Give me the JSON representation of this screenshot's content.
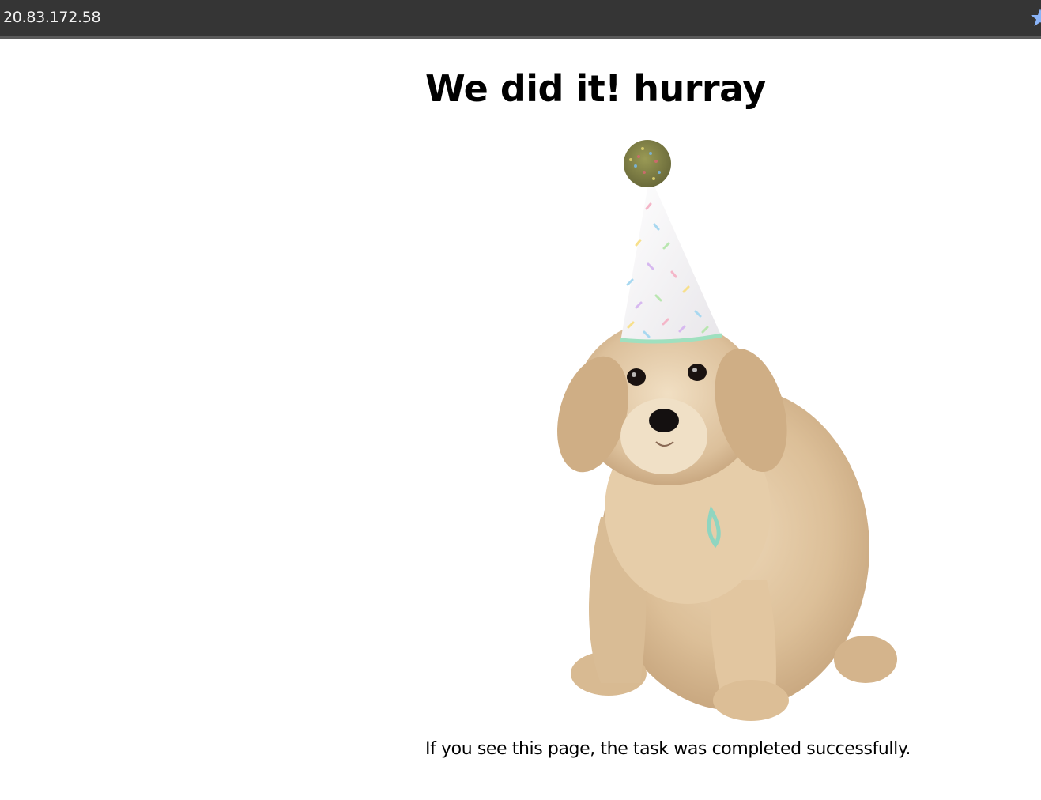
{
  "browser": {
    "url": "20.83.172.58",
    "star_icon": "bookmark-star-icon"
  },
  "main": {
    "heading": "We did it! hurray",
    "image": {
      "subject": "party-dog-photo"
    },
    "caption": "If you see this page, the task was completed successfully."
  },
  "colors": {
    "browser_bar": "#353535",
    "url_text": "#f2f2f2",
    "star": "#8ab4f8",
    "page_background": "#ffffff",
    "text": "#000000"
  }
}
